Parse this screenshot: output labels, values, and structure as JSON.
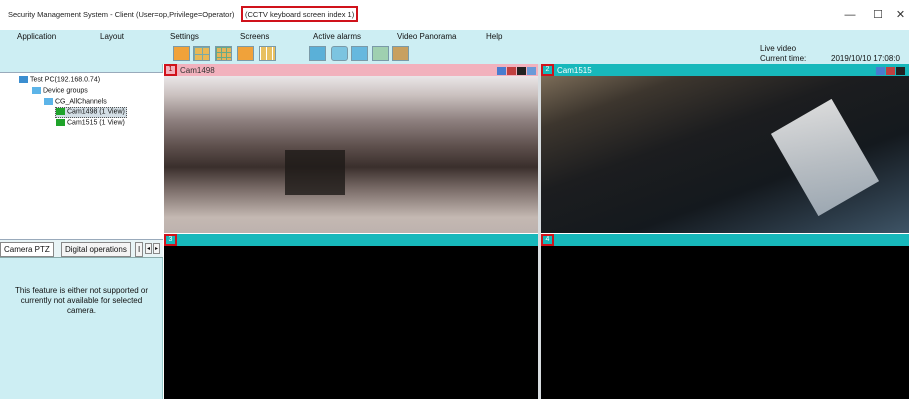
{
  "window": {
    "title": "Security Management System - Client (User=op,Privilege=Operator)",
    "title_extra": "(CCTV keyboard screen index 1)",
    "minimize": "—",
    "maximize": "☐",
    "close": "✕"
  },
  "menu": {
    "items": [
      "Application",
      "Layout",
      "Settings",
      "Screens",
      "Active alarms",
      "Video Panorama",
      "Help"
    ]
  },
  "toolbar": {
    "icons": [
      "layout-1x1-icon",
      "layout-2x2-icon",
      "layout-3x3-icon",
      "layout-4x4-icon",
      "layout-custom-icon",
      "monitor-icon",
      "camera-view-icon",
      "map-icon",
      "search-icon",
      "settings-icon"
    ]
  },
  "status": {
    "live_video": "Live video",
    "current_time_label": "Current time:",
    "current_time_value": "2019/10/10 17:08:0"
  },
  "tree": {
    "root": "Test PC(192.168.0.74)",
    "group": "Device groups",
    "subgroup": "CG_AllChannels",
    "cameras": [
      "Cam1498 (1 View)",
      "Cam1515 (1 View)"
    ]
  },
  "ptz": {
    "tabs": [
      "Camera PTZ",
      "Digital operations",
      "I"
    ],
    "message": "This feature is either not supported or currently not available for selected camera."
  },
  "video": {
    "panes": [
      {
        "index": "1",
        "name": "Cam1498"
      },
      {
        "index": "2",
        "name": "Cam1515"
      },
      {
        "index": "3",
        "name": ""
      },
      {
        "index": "4",
        "name": ""
      }
    ]
  },
  "colors": {
    "accent": "#17b8bb",
    "pane1_header": "#f2b1bd",
    "highlight": "#d0121b",
    "panel_bg": "#cdeef3"
  }
}
